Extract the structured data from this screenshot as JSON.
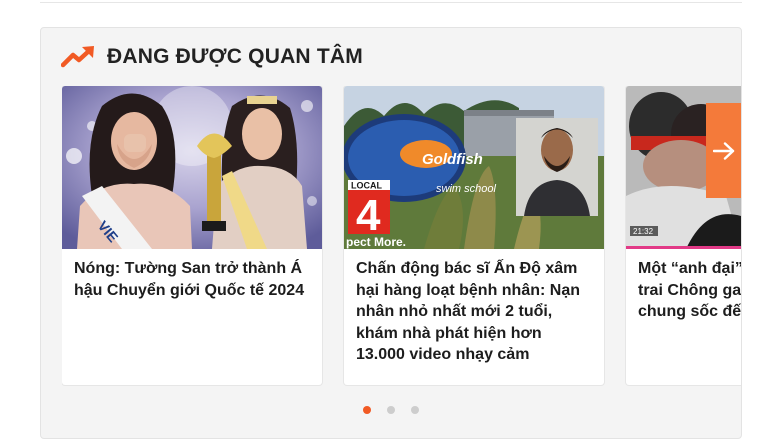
{
  "section": {
    "title": "ĐANG ĐƯỢC QUAN TÂM",
    "icon": "trending-up-icon",
    "accent": "#f15a24"
  },
  "cards": [
    {
      "title": "Nóng: Tường San trở thành Á hậu Chuyển giới Quốc tế 2024"
    },
    {
      "title": "Chấn động bác sĩ Ấn Độ xâm hại hàng loạt bệnh nhân: Nạn nhân nhỏ nhất mới 2 tuổi, khám nhà phát hiện hơn 13.000 video nhạy cảm",
      "thumb": {
        "channel_label": "LOCAL",
        "channel_number": "4",
        "tagline": "pect More.",
        "sign_line1": "Goldfish",
        "sign_line2": "swim school"
      }
    },
    {
      "title": "Một “anh đại” trai Chông ga chung sốc đế",
      "title_lines": [
        "Một “anh đại”",
        "trai Chông ga",
        "chung sốc đế"
      ],
      "thumb": {
        "timestamp": "21:32"
      }
    }
  ],
  "carousel": {
    "next_icon": "arrow-right-icon",
    "pages": 3,
    "active_page": 1
  }
}
